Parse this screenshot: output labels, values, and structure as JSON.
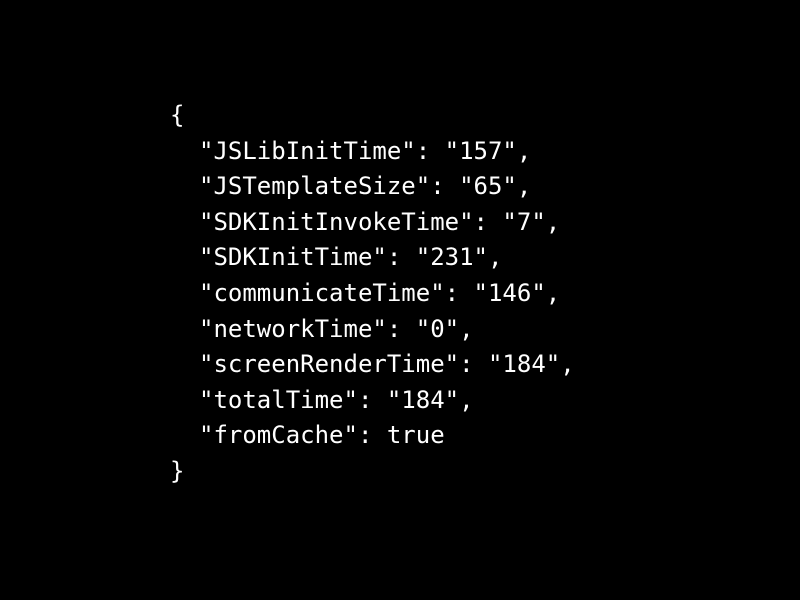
{
  "json_document": {
    "open_brace": "{",
    "close_brace": "}",
    "entries": [
      {
        "text": "\"JSLibInitTime\": \"157\","
      },
      {
        "text": "\"JSTemplateSize\": \"65\","
      },
      {
        "text": "\"SDKInitInvokeTime\": \"7\","
      },
      {
        "text": "\"SDKInitTime\": \"231\","
      },
      {
        "text": "\"communicateTime\": \"146\","
      },
      {
        "text": "\"networkTime\": \"0\","
      },
      {
        "text": "\"screenRenderTime\": \"184\","
      },
      {
        "text": "\"totalTime\": \"184\","
      },
      {
        "text": "\"fromCache\": true"
      }
    ]
  },
  "colors": {
    "background": "#000000",
    "text": "#ffffff"
  }
}
